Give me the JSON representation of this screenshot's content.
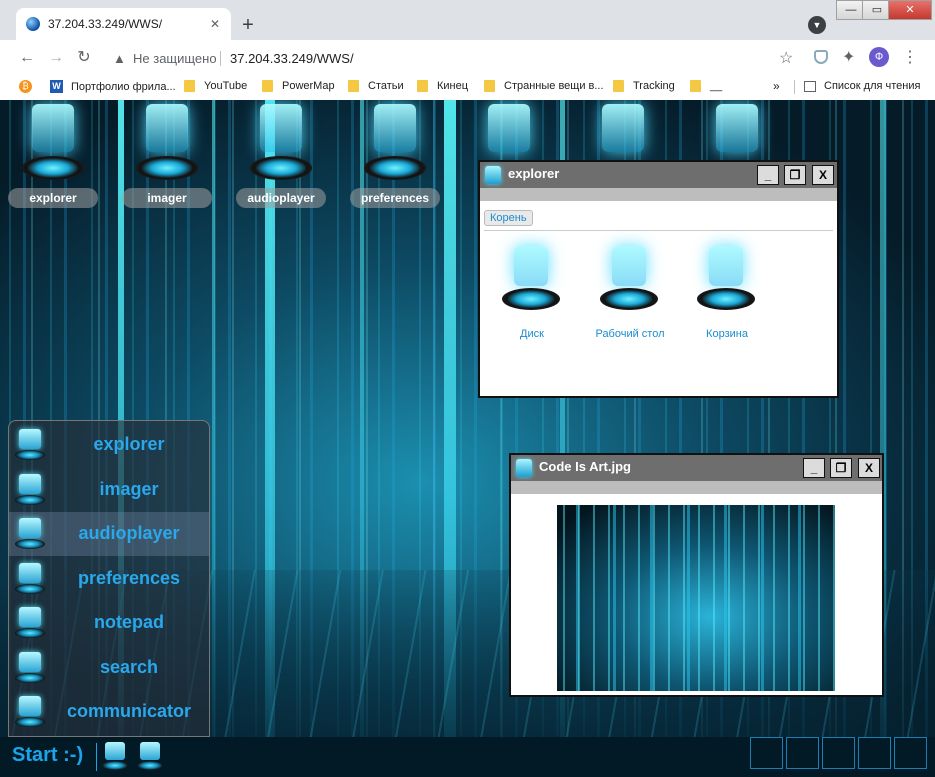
{
  "browser": {
    "tab_title": "37.204.33.249/WWS/",
    "tab_close": "✕",
    "new_tab": "+",
    "insecure_label": "Не защищено",
    "url": "37.204.33.249/WWS/",
    "profile_initial": "Ф",
    "window_buttons": {
      "minimize": "—",
      "maximize": "▭",
      "close": "✕"
    },
    "bookmarks": [
      {
        "label": "Портфолио фрила...",
        "icon": "w-icon"
      },
      {
        "label": "YouTube",
        "icon": "folder-icon"
      },
      {
        "label": "PowerMap",
        "icon": "folder-icon"
      },
      {
        "label": "Статьи",
        "icon": "folder-icon"
      },
      {
        "label": "Кинец",
        "icon": "folder-icon"
      },
      {
        "label": "Странные вещи в...",
        "icon": "folder-icon"
      },
      {
        "label": "Tracking",
        "icon": "folder-icon"
      },
      {
        "label": "__",
        "icon": "folder-icon"
      }
    ],
    "bookmarks_more": "»",
    "reading_list": "Список для чтения"
  },
  "desktop": {
    "icons": [
      {
        "label": "explorer"
      },
      {
        "label": "imager"
      },
      {
        "label": "audioplayer"
      },
      {
        "label": "preferences"
      }
    ]
  },
  "explorer_window": {
    "title": "explorer",
    "buttons": {
      "minimize": "_",
      "maximize": "❐",
      "close": "X"
    },
    "breadcrumb": "Корень",
    "items": [
      {
        "label": "Диск"
      },
      {
        "label": "Рабочий стол"
      },
      {
        "label": "Корзина"
      }
    ]
  },
  "image_window": {
    "title": "Code Is Art.jpg",
    "buttons": {
      "minimize": "_",
      "maximize": "❐",
      "close": "X"
    }
  },
  "start_menu": {
    "items": [
      {
        "label": "explorer"
      },
      {
        "label": "imager"
      },
      {
        "label": "audioplayer",
        "active": true
      },
      {
        "label": "preferences"
      },
      {
        "label": "notepad"
      },
      {
        "label": "search"
      },
      {
        "label": "communicator"
      }
    ]
  },
  "taskbar": {
    "start_label": "Start :-)"
  },
  "colors": {
    "accent": "#29a8ec",
    "link": "#1a8ccf",
    "window_title": "#6e6e6e"
  }
}
